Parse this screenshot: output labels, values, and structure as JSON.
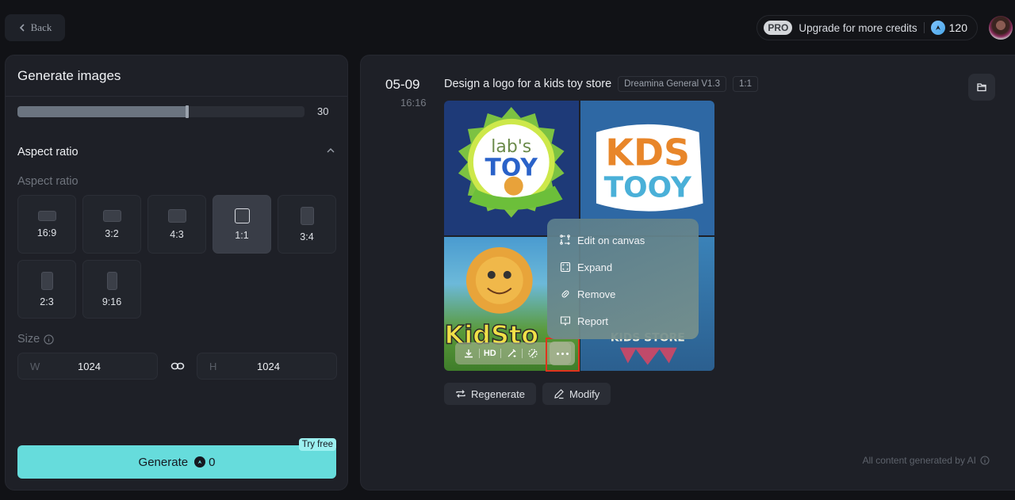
{
  "topbar": {
    "back_label": "Back",
    "pro_badge": "PRO",
    "upgrade_label": "Upgrade for more credits",
    "credits": "120"
  },
  "left_panel": {
    "title": "Generate images",
    "slider": {
      "value": "30",
      "fill_fraction": 0.59
    },
    "aspect_section_title": "Aspect ratio",
    "aspect_sub_label": "Aspect ratio",
    "ratios": [
      {
        "label": "16:9",
        "selected": false
      },
      {
        "label": "3:2",
        "selected": false
      },
      {
        "label": "4:3",
        "selected": false
      },
      {
        "label": "1:1",
        "selected": true
      },
      {
        "label": "3:4",
        "selected": false
      },
      {
        "label": "2:3",
        "selected": false
      },
      {
        "label": "9:16",
        "selected": false
      }
    ],
    "size_label": "Size",
    "width_axis": "W",
    "width_value": "1024",
    "height_axis": "H",
    "height_value": "1024",
    "generate_label": "Generate",
    "generate_cost": "0",
    "try_free_badge": "Try free"
  },
  "result": {
    "date": "05-09",
    "time": "16:16",
    "prompt": "Design a logo for a kids toy store",
    "model_tag": "Dreamina General V1.3",
    "ratio_tag": "1:1",
    "images": [
      {
        "alt": "Lab's Toy badge logo"
      },
      {
        "alt": "KDS TOOY logo"
      },
      {
        "alt": "Kid Store sun mascot logo"
      },
      {
        "alt": "Kids store logo"
      }
    ],
    "toolbar": {
      "hd_label": "HD"
    },
    "context_menu": [
      {
        "label": "Edit on canvas",
        "icon": "edit-canvas-icon"
      },
      {
        "label": "Expand",
        "icon": "expand-icon"
      },
      {
        "label": "Remove",
        "icon": "eraser-icon"
      },
      {
        "label": "Report",
        "icon": "report-icon"
      }
    ],
    "regenerate_label": "Regenerate",
    "modify_label": "Modify",
    "ai_note": "All content generated by AI"
  }
}
